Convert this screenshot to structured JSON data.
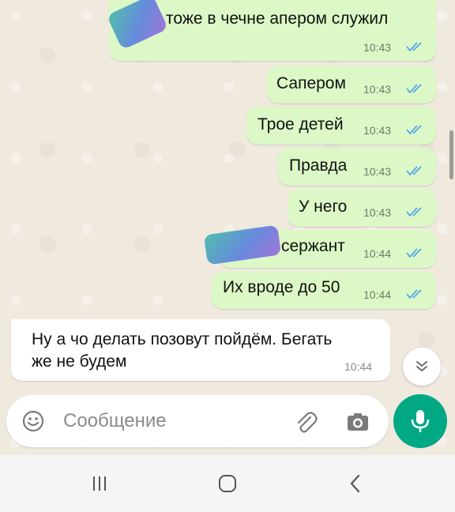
{
  "messages": [
    {
      "direction": "out",
      "text": "тоже в чечне апером служил",
      "time": "10:43",
      "read": true
    },
    {
      "direction": "out",
      "text": "Сапером",
      "time": "10:43",
      "read": true
    },
    {
      "direction": "out",
      "text": "Трое детей",
      "time": "10:43",
      "read": true
    },
    {
      "direction": "out",
      "text": "Правда",
      "time": "10:43",
      "read": true
    },
    {
      "direction": "out",
      "text": "У него",
      "time": "10:43",
      "read": true
    },
    {
      "direction": "out",
      "text": "сержант",
      "time": "10:44",
      "read": true
    },
    {
      "direction": "out",
      "text": "Их вроде до 50",
      "time": "10:44",
      "read": true
    },
    {
      "direction": "in",
      "text_line1": "Ну а чо делать позовут пойдём. Бегать",
      "text_line2": "же не будем",
      "time": "10:44"
    }
  ],
  "composer": {
    "placeholder": "Сообщение",
    "emoji_icon": "emoji-icon",
    "attach_icon": "paperclip-icon",
    "camera_icon": "camera-icon",
    "mic_icon": "microphone-icon"
  },
  "scroll_button_icon": "double-chevron-down-icon",
  "nav": {
    "recent": "recent-apps-icon",
    "home": "home-icon",
    "back": "back-icon"
  },
  "colors": {
    "outgoing_bubble": "#dcf8c6",
    "incoming_bubble": "#ffffff",
    "read_ticks": "#53a6e8",
    "accent": "#00a884",
    "chat_background": "#efe9de"
  }
}
